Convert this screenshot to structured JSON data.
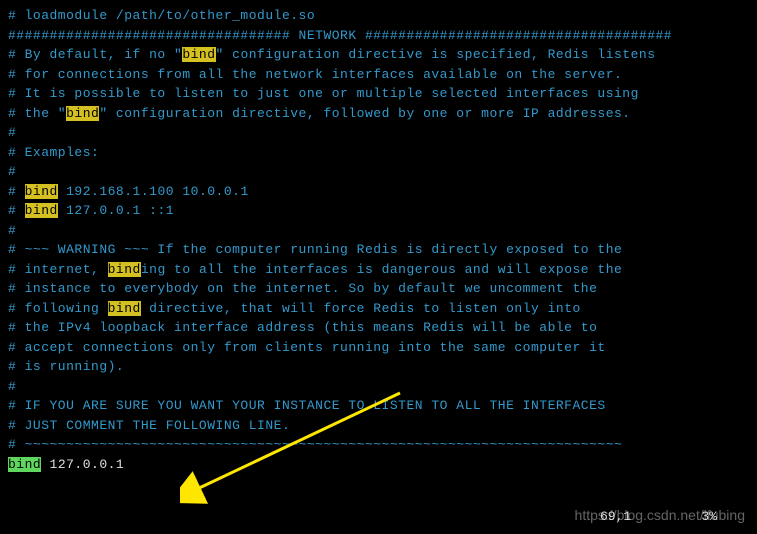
{
  "lines": {
    "l1": "# loadmodule /path/to/other_module.so",
    "l2": "",
    "l3": "################################## NETWORK #####################################",
    "l4": "",
    "l5a": "# By default, if no \"",
    "l5b": "bind",
    "l5c": "\" configuration directive is specified, Redis listens",
    "l6": "# for connections from all the network interfaces available on the server.",
    "l7": "# It is possible to listen to just one or multiple selected interfaces using",
    "l8a": "# the \"",
    "l8b": "bind",
    "l8c": "\" configuration directive, followed by one or more IP addresses.",
    "l9": "#",
    "l10": "# Examples:",
    "l11": "#",
    "l12a": "# ",
    "l12b": "bind",
    "l12c": " 192.168.1.100 10.0.0.1",
    "l13a": "# ",
    "l13b": "bind",
    "l13c": " 127.0.0.1 ::1",
    "l14": "#",
    "l15": "# ~~~ WARNING ~~~ If the computer running Redis is directly exposed to the",
    "l16a": "# internet, ",
    "l16b": "bind",
    "l16c": "ing to all the interfaces is dangerous and will expose the",
    "l17": "# instance to everybody on the internet. So by default we uncomment the",
    "l18a": "# following ",
    "l18b": "bind",
    "l18c": " directive, that will force Redis to listen only into",
    "l19": "# the IPv4 loopback interface address (this means Redis will be able to",
    "l20": "# accept connections only from clients running into the same computer it",
    "l21": "# is running).",
    "l22": "#",
    "l23": "# IF YOU ARE SURE YOU WANT YOUR INSTANCE TO LISTEN TO ALL THE INTERFACES",
    "l24": "# JUST COMMENT THE FOLLOWING LINE.",
    "l25": "# ~~~~~~~~~~~~~~~~~~~~~~~~~~~~~~~~~~~~~~~~~~~~~~~~~~~~~~~~~~~~~~~~~~~~~~~~",
    "l26a": "bind",
    "l26b": " 127.0.0.1"
  },
  "status": {
    "pos": "69,1",
    "pct": "3%"
  },
  "watermark": "https://blog.csdn.net/ifubing"
}
